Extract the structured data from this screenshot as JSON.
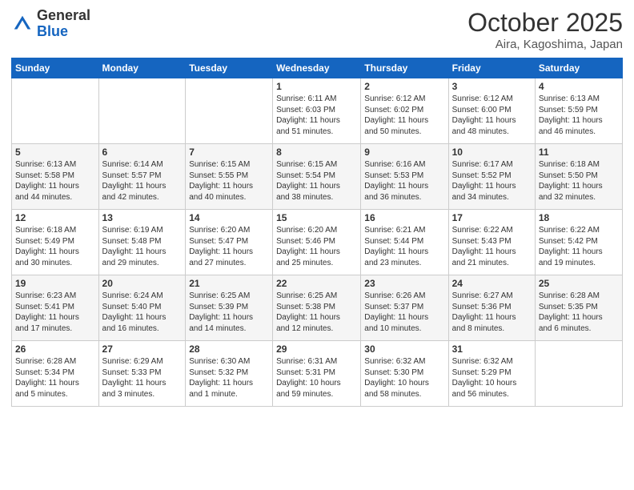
{
  "header": {
    "logo_general": "General",
    "logo_blue": "Blue",
    "month_title": "October 2025",
    "location": "Aira, Kagoshima, Japan"
  },
  "weekdays": [
    "Sunday",
    "Monday",
    "Tuesday",
    "Wednesday",
    "Thursday",
    "Friday",
    "Saturday"
  ],
  "weeks": [
    [
      {
        "day": "",
        "info": ""
      },
      {
        "day": "",
        "info": ""
      },
      {
        "day": "",
        "info": ""
      },
      {
        "day": "1",
        "info": "Sunrise: 6:11 AM\nSunset: 6:03 PM\nDaylight: 11 hours\nand 51 minutes."
      },
      {
        "day": "2",
        "info": "Sunrise: 6:12 AM\nSunset: 6:02 PM\nDaylight: 11 hours\nand 50 minutes."
      },
      {
        "day": "3",
        "info": "Sunrise: 6:12 AM\nSunset: 6:00 PM\nDaylight: 11 hours\nand 48 minutes."
      },
      {
        "day": "4",
        "info": "Sunrise: 6:13 AM\nSunset: 5:59 PM\nDaylight: 11 hours\nand 46 minutes."
      }
    ],
    [
      {
        "day": "5",
        "info": "Sunrise: 6:13 AM\nSunset: 5:58 PM\nDaylight: 11 hours\nand 44 minutes."
      },
      {
        "day": "6",
        "info": "Sunrise: 6:14 AM\nSunset: 5:57 PM\nDaylight: 11 hours\nand 42 minutes."
      },
      {
        "day": "7",
        "info": "Sunrise: 6:15 AM\nSunset: 5:55 PM\nDaylight: 11 hours\nand 40 minutes."
      },
      {
        "day": "8",
        "info": "Sunrise: 6:15 AM\nSunset: 5:54 PM\nDaylight: 11 hours\nand 38 minutes."
      },
      {
        "day": "9",
        "info": "Sunrise: 6:16 AM\nSunset: 5:53 PM\nDaylight: 11 hours\nand 36 minutes."
      },
      {
        "day": "10",
        "info": "Sunrise: 6:17 AM\nSunset: 5:52 PM\nDaylight: 11 hours\nand 34 minutes."
      },
      {
        "day": "11",
        "info": "Sunrise: 6:18 AM\nSunset: 5:50 PM\nDaylight: 11 hours\nand 32 minutes."
      }
    ],
    [
      {
        "day": "12",
        "info": "Sunrise: 6:18 AM\nSunset: 5:49 PM\nDaylight: 11 hours\nand 30 minutes."
      },
      {
        "day": "13",
        "info": "Sunrise: 6:19 AM\nSunset: 5:48 PM\nDaylight: 11 hours\nand 29 minutes."
      },
      {
        "day": "14",
        "info": "Sunrise: 6:20 AM\nSunset: 5:47 PM\nDaylight: 11 hours\nand 27 minutes."
      },
      {
        "day": "15",
        "info": "Sunrise: 6:20 AM\nSunset: 5:46 PM\nDaylight: 11 hours\nand 25 minutes."
      },
      {
        "day": "16",
        "info": "Sunrise: 6:21 AM\nSunset: 5:44 PM\nDaylight: 11 hours\nand 23 minutes."
      },
      {
        "day": "17",
        "info": "Sunrise: 6:22 AM\nSunset: 5:43 PM\nDaylight: 11 hours\nand 21 minutes."
      },
      {
        "day": "18",
        "info": "Sunrise: 6:22 AM\nSunset: 5:42 PM\nDaylight: 11 hours\nand 19 minutes."
      }
    ],
    [
      {
        "day": "19",
        "info": "Sunrise: 6:23 AM\nSunset: 5:41 PM\nDaylight: 11 hours\nand 17 minutes."
      },
      {
        "day": "20",
        "info": "Sunrise: 6:24 AM\nSunset: 5:40 PM\nDaylight: 11 hours\nand 16 minutes."
      },
      {
        "day": "21",
        "info": "Sunrise: 6:25 AM\nSunset: 5:39 PM\nDaylight: 11 hours\nand 14 minutes."
      },
      {
        "day": "22",
        "info": "Sunrise: 6:25 AM\nSunset: 5:38 PM\nDaylight: 11 hours\nand 12 minutes."
      },
      {
        "day": "23",
        "info": "Sunrise: 6:26 AM\nSunset: 5:37 PM\nDaylight: 11 hours\nand 10 minutes."
      },
      {
        "day": "24",
        "info": "Sunrise: 6:27 AM\nSunset: 5:36 PM\nDaylight: 11 hours\nand 8 minutes."
      },
      {
        "day": "25",
        "info": "Sunrise: 6:28 AM\nSunset: 5:35 PM\nDaylight: 11 hours\nand 6 minutes."
      }
    ],
    [
      {
        "day": "26",
        "info": "Sunrise: 6:28 AM\nSunset: 5:34 PM\nDaylight: 11 hours\nand 5 minutes."
      },
      {
        "day": "27",
        "info": "Sunrise: 6:29 AM\nSunset: 5:33 PM\nDaylight: 11 hours\nand 3 minutes."
      },
      {
        "day": "28",
        "info": "Sunrise: 6:30 AM\nSunset: 5:32 PM\nDaylight: 11 hours\nand 1 minute."
      },
      {
        "day": "29",
        "info": "Sunrise: 6:31 AM\nSunset: 5:31 PM\nDaylight: 10 hours\nand 59 minutes."
      },
      {
        "day": "30",
        "info": "Sunrise: 6:32 AM\nSunset: 5:30 PM\nDaylight: 10 hours\nand 58 minutes."
      },
      {
        "day": "31",
        "info": "Sunrise: 6:32 AM\nSunset: 5:29 PM\nDaylight: 10 hours\nand 56 minutes."
      },
      {
        "day": "",
        "info": ""
      }
    ]
  ]
}
